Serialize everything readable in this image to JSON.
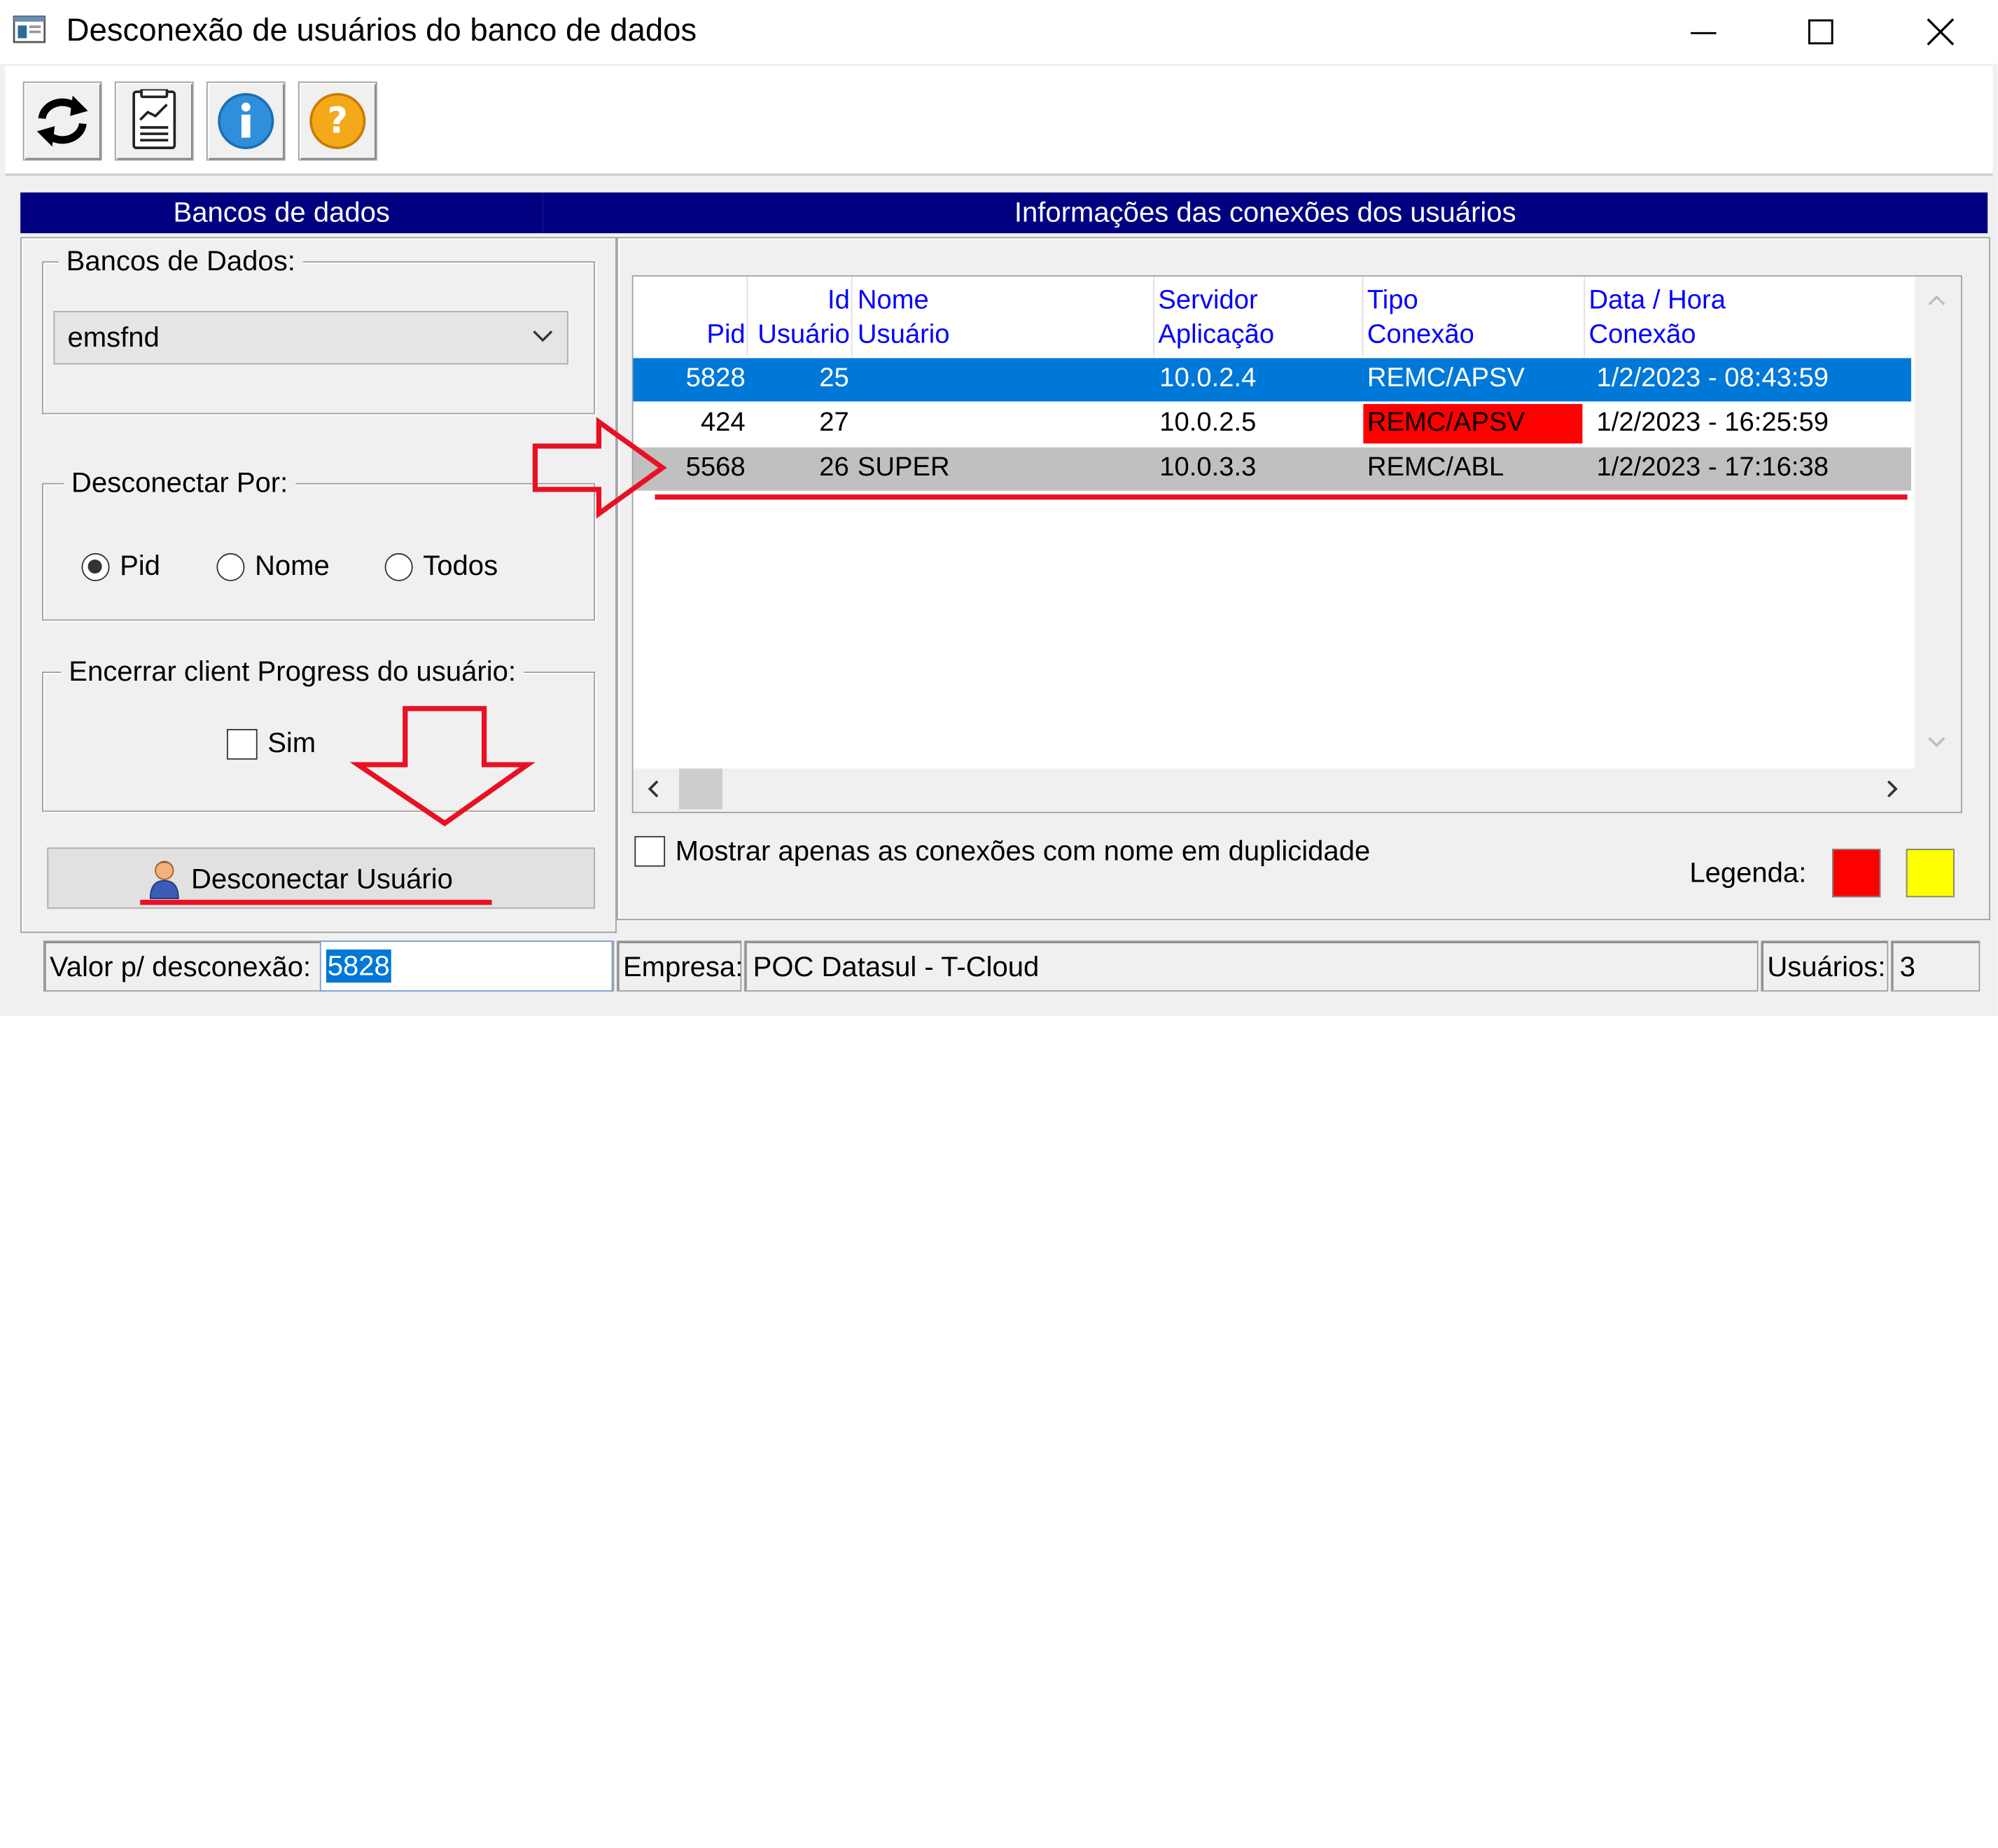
{
  "window": {
    "title": "Desconexão de usuários do banco de dados",
    "controls": [
      "minimize",
      "maximize",
      "close"
    ]
  },
  "toolbar": {
    "buttons": [
      {
        "icon": "refresh-icon"
      },
      {
        "icon": "report-chart-icon"
      },
      {
        "icon": "info-icon"
      },
      {
        "icon": "help-icon"
      }
    ]
  },
  "left_header": "Bancos de dados",
  "right_header": "Informações das conexões dos usuários",
  "databases_group": {
    "label": "Bancos de Dados:",
    "selected": "emsfnd"
  },
  "disconnect_by": {
    "label": "Desconectar Por:",
    "options": [
      "Pid",
      "Nome",
      "Todos"
    ],
    "selected": "Pid"
  },
  "close_client": {
    "label": "Encerrar client Progress do usuário:",
    "checkbox_label": "Sim",
    "checked": false
  },
  "disconnect_button": {
    "label": "Desconectar Usuário",
    "icon": "user-icon"
  },
  "table": {
    "columns": [
      {
        "line1": "",
        "line2": "Pid"
      },
      {
        "line1": "Id",
        "line2": "Usuário"
      },
      {
        "line1": "Nome",
        "line2": "Usuário"
      },
      {
        "line1": "Servidor",
        "line2": "Aplicação"
      },
      {
        "line1": "Tipo",
        "line2": "Conexão"
      },
      {
        "line1": "Data / Hora",
        "line2": "Conexão"
      }
    ],
    "rows": [
      {
        "pid": "5828",
        "id": "25",
        "name": "",
        "server": "10.0.2.4",
        "type": "REMC/APSV",
        "datetime": "1/2/2023 - 08:43:59",
        "state": "selected"
      },
      {
        "pid": "424",
        "id": "27",
        "name": "",
        "server": "10.0.2.5",
        "type": "REMC/APSV",
        "datetime": "1/2/2023 - 16:25:59",
        "state": "normal",
        "type_highlight": "#ff0000"
      },
      {
        "pid": "5568",
        "id": "26",
        "name": "SUPER",
        "server": "10.0.3.3",
        "type": "REMC/ABL",
        "datetime": "1/2/2023 - 17:16:38",
        "state": "gray"
      }
    ]
  },
  "duplicates_checkbox": {
    "label": "Mostrar apenas as conexões com nome em duplicidade",
    "checked": false
  },
  "legend": {
    "label": "Legenda:",
    "colors": [
      "#ff0000",
      "#ffff00"
    ]
  },
  "statusbar": {
    "value_label": "Valor p/ desconexão:",
    "value": "5828",
    "company_label": "Empresa:",
    "company": "POC Datasul - T-Cloud",
    "users_label": "Usuários:",
    "users": "3"
  },
  "colors": {
    "header_bg": "#000080",
    "selected_row": "#0078d7",
    "gray_row": "#c0c0c0",
    "annotation": "#e81123"
  }
}
